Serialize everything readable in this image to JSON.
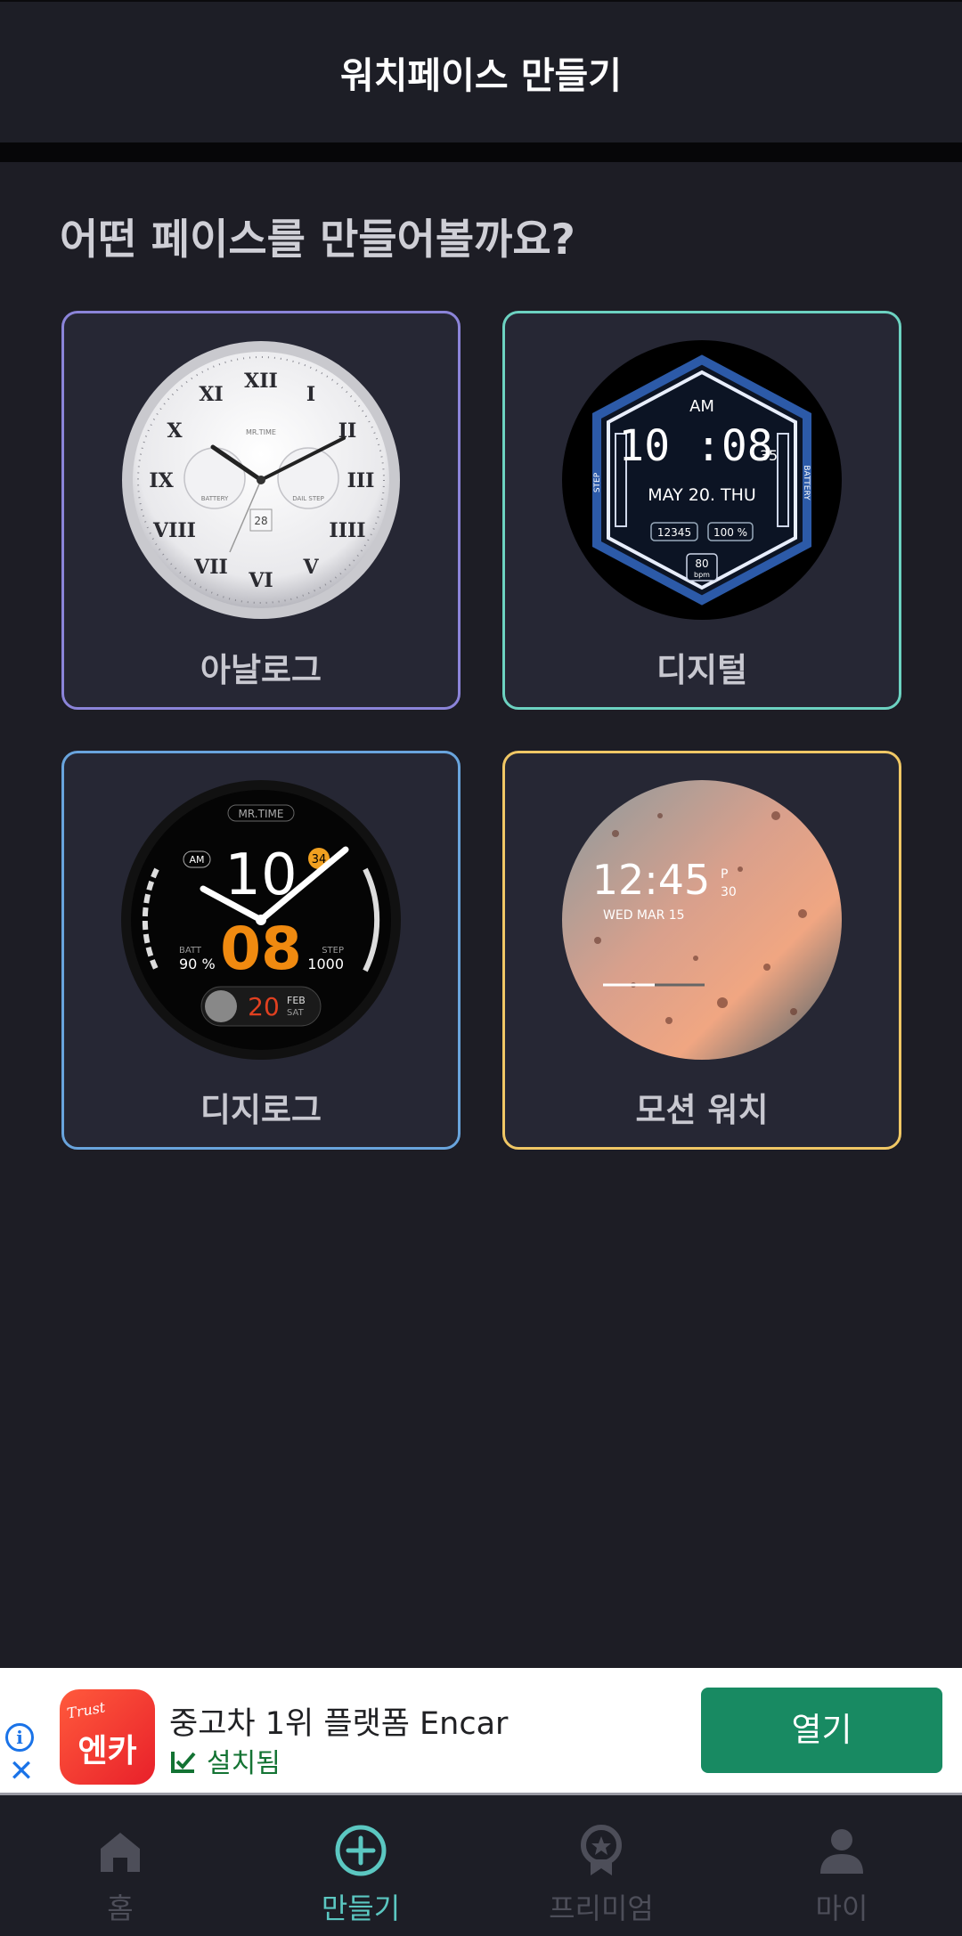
{
  "app_bar": {
    "title": "워치페이스 만들기"
  },
  "question": "어떤 페이스를 만들어볼까요?",
  "cards": [
    {
      "label": "아날로그",
      "border": "#8b84d9"
    },
    {
      "label": "디지털",
      "border": "#6cd2c1"
    },
    {
      "label": "디지로그",
      "border": "#69a4dd"
    },
    {
      "label": "모션 워치",
      "border": "#f0c765"
    }
  ],
  "faces": {
    "analog": {
      "brand": "MR.TIME",
      "numerals": [
        "XII",
        "I",
        "II",
        "III",
        "IIII",
        "V",
        "VI",
        "VII",
        "VIII",
        "IX",
        "X",
        "XI"
      ],
      "sub_left": "BATTERY",
      "sub_right": "DAIL STEP",
      "date": "28"
    },
    "digital": {
      "ampm": "AM",
      "time": "10 :08",
      "seconds": "35",
      "date": "MAY 20. THU",
      "steps": "12345",
      "battery": "100 %",
      "bpm_value": "80",
      "bpm_unit": "bpm",
      "left_label": "STEP",
      "right_label": "BATTERY"
    },
    "digilog": {
      "brand": "MR.TIME",
      "ampm": "AM",
      "hour": "10",
      "badge": "34",
      "minute": "08",
      "batt_label": "BATT",
      "batt_value": "90 %",
      "step_label": "STEP",
      "step_value": "1000",
      "day": "20",
      "month": "FEB",
      "weekday": "SAT"
    },
    "motion": {
      "time": "12:45",
      "ampm": "P",
      "seconds": "30",
      "date": "WED MAR 15"
    }
  },
  "ad": {
    "info_icon": "i",
    "logo_small": "Trust",
    "logo_main": "엔카",
    "title": "중고차 1위 플랫폼 Encar",
    "status": "설치됨",
    "button": "열기"
  },
  "nav": {
    "items": [
      {
        "label": "홈",
        "icon": "home-icon"
      },
      {
        "label": "만들기",
        "icon": "add-circle-icon"
      },
      {
        "label": "프리미엄",
        "icon": "premium-badge-icon"
      },
      {
        "label": "마이",
        "icon": "person-icon"
      }
    ],
    "active_color": "#5bc7c1",
    "inactive_color": "#4d4e59"
  }
}
